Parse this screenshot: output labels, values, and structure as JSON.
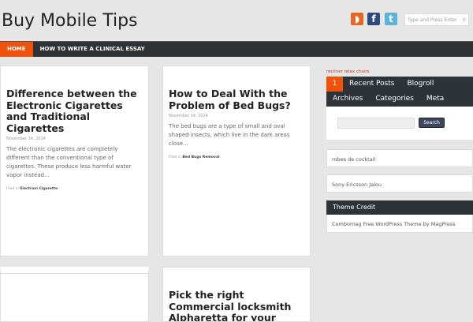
{
  "header": {
    "site_title": "Buy Mobile Tips",
    "search_placeholder": "Type and Press Enter"
  },
  "social": {
    "rss": "rss-icon",
    "facebook": "f",
    "twitter": "t"
  },
  "nav": [
    "HOME",
    "HOW TO WRITE A CLINICAL ESSAY"
  ],
  "posts": [
    {
      "title": "Difference between the Electronic Cigarettes and Traditional Cigarettes",
      "date": "November 14, 2014",
      "excerpt": "The electronic cigarettes are completely different than the conventional type of cigarettes. These produce less harmful water vapor instead...",
      "filed_label": "Filed in",
      "category": "Electroni Cigarette"
    },
    {
      "title": "How to Deal With the Problem of Bed Bugs?",
      "date": "November 14, 2014",
      "excerpt": "The bed bugs are a type of small and oval shaped insects, which live in the dark areas close...",
      "filed_label": "Filed in",
      "category": "Bed Bugs Removal"
    },
    {
      "title": "Pick the right Commercial locksmith Alpharetta for your business security"
    }
  ],
  "sidebar": {
    "link": "recliner relax chairs",
    "tabs": [
      "1",
      "Recent Posts",
      "Blogroll",
      "Archives",
      "Categories",
      "Meta"
    ],
    "search_button": "Search",
    "widget1": "robes de cocktail",
    "widget2": "Sony Ericsson Jalou",
    "credit_title": "Theme Credit",
    "credit_text": "Combomag Free WordPress Theme by MagPress"
  }
}
